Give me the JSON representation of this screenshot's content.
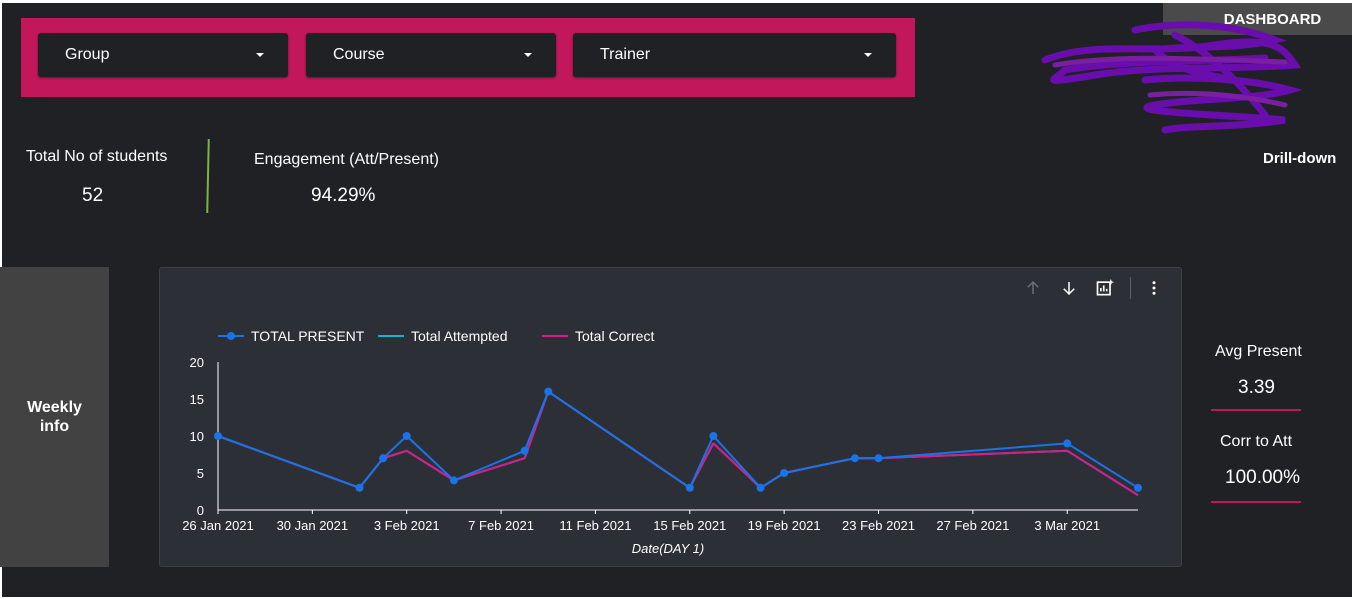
{
  "filters": {
    "group_label": "Group",
    "course_label": "Course",
    "trainer_label": "Trainer"
  },
  "header": {
    "dashboard_tab": "DASHBOARD",
    "drill_down": "Drill-down"
  },
  "kpis": {
    "students_title": "Total No of students",
    "students_value": "52",
    "engagement_title": "Engagement (Att/Present)",
    "engagement_value": "94.29%"
  },
  "weekly": {
    "line1": "Weekly",
    "line2": "info"
  },
  "side_kpis": {
    "avg_present_title": "Avg Present",
    "avg_present_value": "3.39",
    "corr_att_title": "Corr to Att",
    "corr_att_value": "100.00%"
  },
  "colors": {
    "accent": "#c2185b",
    "present": "#1a73e8",
    "attempted": "#12b5cb",
    "correct": "#d81b8c",
    "divider": "#7cb342"
  },
  "icons": {
    "sort_up": "arrow-up-icon",
    "sort_down": "arrow-down-icon",
    "explore": "chart-explore-icon",
    "more": "more-vert-icon"
  },
  "chart_data": {
    "type": "line",
    "xlabel": "Date(DAY 1)",
    "ylabel": "",
    "ylim": [
      0,
      20
    ],
    "yticks": [
      0,
      5,
      10,
      15,
      20
    ],
    "x_ticks": [
      "26 Jan 2021",
      "30 Jan 2021",
      "3 Feb 2021",
      "7 Feb 2021",
      "11 Feb 2021",
      "15 Feb 2021",
      "19 Feb 2021",
      "23 Feb 2021",
      "27 Feb 2021",
      "3 Mar 2021"
    ],
    "x": [
      "2021-01-26",
      "2021-02-01",
      "2021-02-02",
      "2021-02-03",
      "2021-02-05",
      "2021-02-08",
      "2021-02-09",
      "2021-02-15",
      "2021-02-16",
      "2021-02-18",
      "2021-02-19",
      "2021-02-22",
      "2021-02-23",
      "2021-03-03",
      "2021-03-06"
    ],
    "legend_position": "top-left",
    "series": [
      {
        "name": "TOTAL PRESENT",
        "values": [
          10,
          3,
          7,
          10,
          4,
          8,
          16,
          3,
          10,
          3,
          5,
          7,
          7,
          9,
          3
        ],
        "markers": true
      },
      {
        "name": "Total Attempted",
        "values": [
          10,
          3,
          7,
          8,
          4,
          7,
          16,
          3,
          9,
          3,
          5,
          7,
          7,
          8,
          2
        ],
        "markers": false
      },
      {
        "name": "Total Correct",
        "values": [
          10,
          3,
          7,
          8,
          4,
          7,
          16,
          3,
          9,
          3,
          5,
          7,
          7,
          8,
          2
        ],
        "markers": false
      }
    ]
  }
}
